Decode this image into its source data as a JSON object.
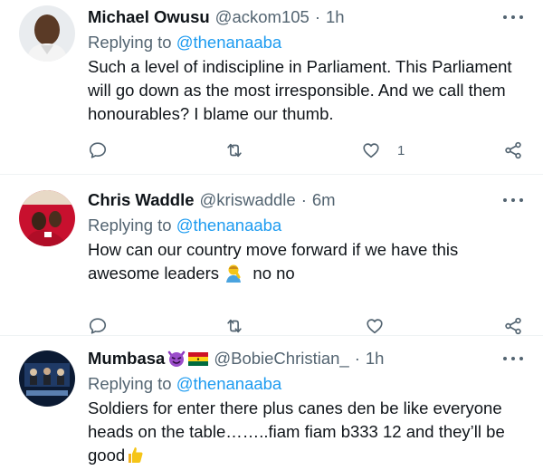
{
  "tweets": [
    {
      "name": "Michael Owusu",
      "handle": "@ackom105",
      "dot": "·",
      "time": "1h",
      "replying_prefix": "Replying to",
      "replying_to": "@thenanaaba",
      "text": "Such a level of indiscipline in Parliament. This Parliament will go down as the most irresponsible. And we call them honourables? I blame our thumb.",
      "like_count": "1"
    },
    {
      "name": "Chris Waddle",
      "handle": "@kriswaddle",
      "dot": "·",
      "time": "6m",
      "replying_prefix": "Replying to",
      "replying_to": "@thenanaaba",
      "text_part1": "How can our country move forward if we have this awesome leaders",
      "text_part2": "no no",
      "like_count": ""
    },
    {
      "name": "Mumbasa",
      "handle": "@BobieChristian_",
      "dot": "·",
      "time": "1h",
      "replying_prefix": "Replying to",
      "replying_to": "@thenanaaba",
      "text": "Soldiers for enter there plus canes den be like everyone heads on the table……..fiam fiam b333 12 and they’ll be good",
      "like_count": ""
    }
  ],
  "icons": {
    "reply": "reply-icon",
    "retweet": "retweet-icon",
    "like": "heart-icon",
    "share": "share-icon",
    "more": "more-icon"
  },
  "colors": {
    "accent": "#1d9bf0",
    "secondary_text": "#536471",
    "primary_text": "#0f1419"
  }
}
